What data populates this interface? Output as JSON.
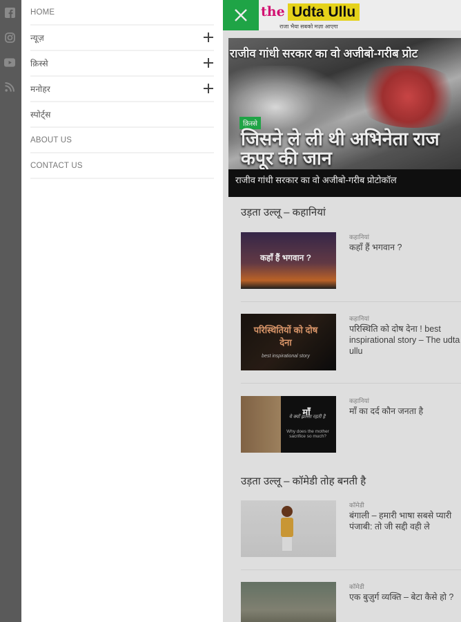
{
  "social": [
    {
      "icon": "facebook-icon"
    },
    {
      "icon": "instagram-icon"
    },
    {
      "icon": "youtube-icon"
    },
    {
      "icon": "rss-icon"
    }
  ],
  "menu": {
    "items": [
      {
        "label": "HOME",
        "expandable": false
      },
      {
        "label": "न्यूज़",
        "expandable": true
      },
      {
        "label": "क़िस्से",
        "expandable": true
      },
      {
        "label": "मनोहर",
        "expandable": true
      },
      {
        "label": "स्पोर्ट्स",
        "expandable": false
      },
      {
        "label": "ABOUT US",
        "expandable": false
      },
      {
        "label": "CONTACT US",
        "expandable": false
      }
    ]
  },
  "header": {
    "logo_the": "the",
    "logo_name": "Udta Ullu",
    "logo_tagline": "राजा भैया सबको मज़ा आएगा",
    "close_icon": "close-icon",
    "accent": "#22b14c"
  },
  "hero": {
    "top_line": "राजीव गांधी सरकार का वो अजीबो-गरीब प्रोट",
    "category": "क़िस्से",
    "headline": "जिसने ले ली थी अभिनेता राज कपूर की जान",
    "caption": "राजीव गांधी सरकार का वो अजीबो-गरीब प्रोटोकॉल"
  },
  "sections": [
    {
      "title": "उड़ता उल्लू – कहानियां",
      "cards": [
        {
          "category": "कहानियां",
          "title": "कहाँ हैं भगवान ?",
          "thumb_text": "कहाँ हैं भगवान ?"
        },
        {
          "category": "कहानियां",
          "title": "परिस्थिति को दोष देना ! best inspirational story – The udta ullu",
          "thumb_text": "परिस्थितियों को दोष देना",
          "thumb_sub": "best inspirational story"
        },
        {
          "category": "कहानियां",
          "title": "माँ का दर्द कौन जनता है",
          "thumb_text": "माँ",
          "thumb_sub": "ये क्यों झल्ला रहती है",
          "thumb_sub2": "Why does the mother sacrifice so much?"
        }
      ]
    },
    {
      "title": "उड़ता उल्लू – कॉमेडी तोह बनती है",
      "cards": [
        {
          "category": "कॉमेडी",
          "title": "बंगाली – हमारी भाषा सबसे प्यारी पंजाबी: तो जी सद्दी वही ले"
        },
        {
          "category": "कॉमेडी",
          "title": "एक बुज़ुर्ग व्यक्ति – बेटा कैसे हो ?"
        }
      ]
    }
  ]
}
